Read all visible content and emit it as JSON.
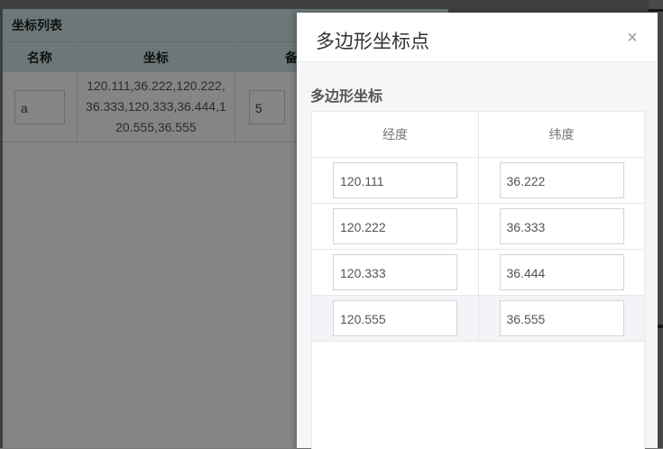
{
  "background": {
    "panel_title": "坐标列表",
    "columns": [
      "名称",
      "坐标",
      "备"
    ],
    "row": {
      "name": "a",
      "coords_lines": [
        "120.111,36.222,120.222,",
        "36.333,120.333,36.444,1",
        "20.555,36.555"
      ],
      "note": "5"
    }
  },
  "drawer": {
    "title": "多边形坐标点",
    "close_icon": "×",
    "section_title": "多边形坐标",
    "columns": [
      "经度",
      "纬度"
    ],
    "rows": [
      {
        "lng": "120.111",
        "lat": "36.222"
      },
      {
        "lng": "120.222",
        "lat": "36.333"
      },
      {
        "lng": "120.333",
        "lat": "36.444"
      },
      {
        "lng": "120.555",
        "lat": "36.555"
      }
    ]
  }
}
